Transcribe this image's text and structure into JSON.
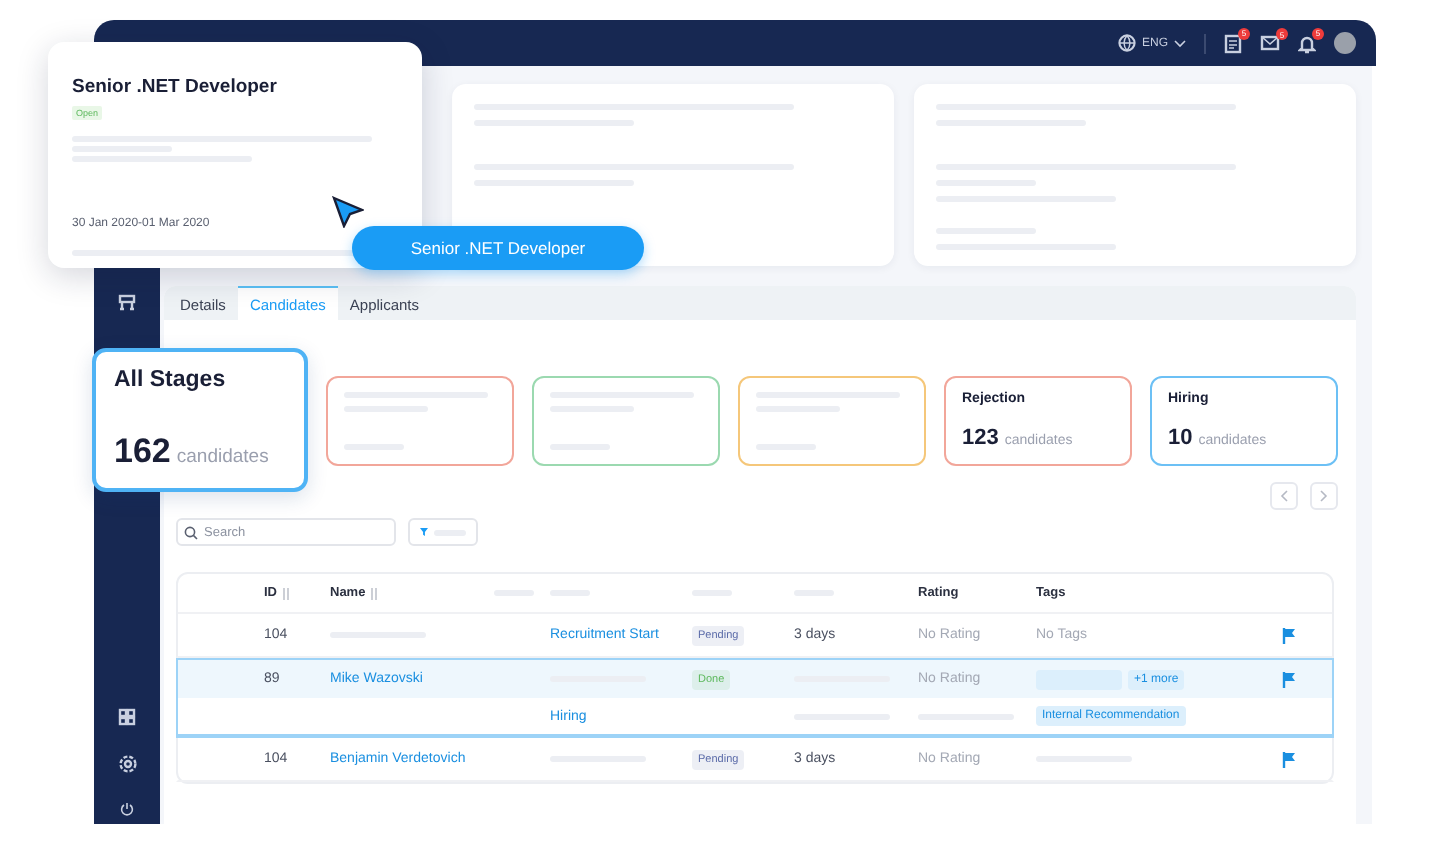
{
  "overlay_card": {
    "title": "Senior .NET Developer",
    "status": "Open",
    "dates": "30 Jan 2020-01 Mar 2020"
  },
  "tooltip": {
    "label": "Senior .NET Developer"
  },
  "top_bar": {
    "language": "ENG",
    "badges": [
      {
        "count": "5"
      },
      {
        "count": "5"
      },
      {
        "count": "5"
      }
    ]
  },
  "tabs": [
    {
      "label": "Details",
      "selected": false
    },
    {
      "label": "Candidates",
      "selected": true
    },
    {
      "label": "Applicants",
      "selected": false
    }
  ],
  "stages": [
    {
      "kind": "summary",
      "title": "All Stages",
      "count": "162",
      "unit": "candidates",
      "color": "#4fb3f5"
    },
    {
      "kind": "placeholder",
      "color": "#f2a69a"
    },
    {
      "kind": "placeholder",
      "color": "#9bd9b0"
    },
    {
      "kind": "placeholder",
      "color": "#f5c77a"
    },
    {
      "kind": "stage",
      "title": "Rejection",
      "count": "123",
      "unit": "candidates",
      "color": "#f2a69a"
    },
    {
      "kind": "stage",
      "title": "Hiring",
      "count": "10",
      "unit": "candidates",
      "color": "#6cc0f5"
    }
  ],
  "search": {
    "placeholder": "Search"
  },
  "table": {
    "columns": [
      {
        "kind": "label",
        "label": "ID",
        "sortable": true
      },
      {
        "kind": "label",
        "label": "Name",
        "sortable": true
      },
      {
        "kind": "placeholder"
      },
      {
        "kind": "placeholder"
      },
      {
        "kind": "placeholder"
      },
      {
        "kind": "placeholder"
      },
      {
        "kind": "label",
        "label": "Rating",
        "sortable": false
      },
      {
        "kind": "label",
        "label": "Tags",
        "sortable": false
      }
    ],
    "rows": [
      {
        "selected": false,
        "flagged": true,
        "cells": [
          {
            "kind": "text",
            "text": "104"
          },
          {
            "kind": "placeholder"
          },
          {
            "kind": "empty"
          },
          {
            "kind": "link",
            "text": "Recruitment Start"
          },
          {
            "kind": "status",
            "text": "Pending",
            "color": "#5a6aa8"
          },
          {
            "kind": "text",
            "text": "3 days"
          },
          {
            "kind": "muted",
            "text": "No Rating"
          },
          {
            "kind": "muted",
            "text": "No Tags"
          }
        ]
      },
      {
        "selected": true,
        "flagged": true,
        "cells": [
          {
            "kind": "text",
            "text": "89"
          },
          {
            "kind": "link",
            "text": "Mike Wazovski"
          },
          {
            "kind": "empty"
          },
          {
            "kind": "placeholder"
          },
          {
            "kind": "status",
            "text": "Done",
            "color": "#5cb85c"
          },
          {
            "kind": "placeholder"
          },
          {
            "kind": "muted",
            "text": "No Rating"
          },
          {
            "kind": "tags",
            "tags": [
              {
                "kind": "placeholder"
              },
              {
                "kind": "text",
                "text": "+1 more"
              }
            ]
          }
        ]
      },
      {
        "selected": true,
        "flagged": false,
        "cells": [
          {
            "kind": "empty"
          },
          {
            "kind": "empty"
          },
          {
            "kind": "empty"
          },
          {
            "kind": "link",
            "text": "Hiring"
          },
          {
            "kind": "empty"
          },
          {
            "kind": "placeholder"
          },
          {
            "kind": "placeholder"
          },
          {
            "kind": "tags",
            "tags": [
              {
                "kind": "text",
                "text": "Internal Recommendation"
              }
            ]
          }
        ]
      },
      {
        "selected": false,
        "flagged": true,
        "cells": [
          {
            "kind": "text",
            "text": "104"
          },
          {
            "kind": "link",
            "text": "Benjamin Verdetovich"
          },
          {
            "kind": "empty"
          },
          {
            "kind": "placeholder"
          },
          {
            "kind": "status",
            "text": "Pending",
            "color": "#5a6aa8"
          },
          {
            "kind": "text",
            "text": "3 days"
          },
          {
            "kind": "muted",
            "text": "No Rating"
          },
          {
            "kind": "placeholder"
          }
        ]
      }
    ]
  }
}
